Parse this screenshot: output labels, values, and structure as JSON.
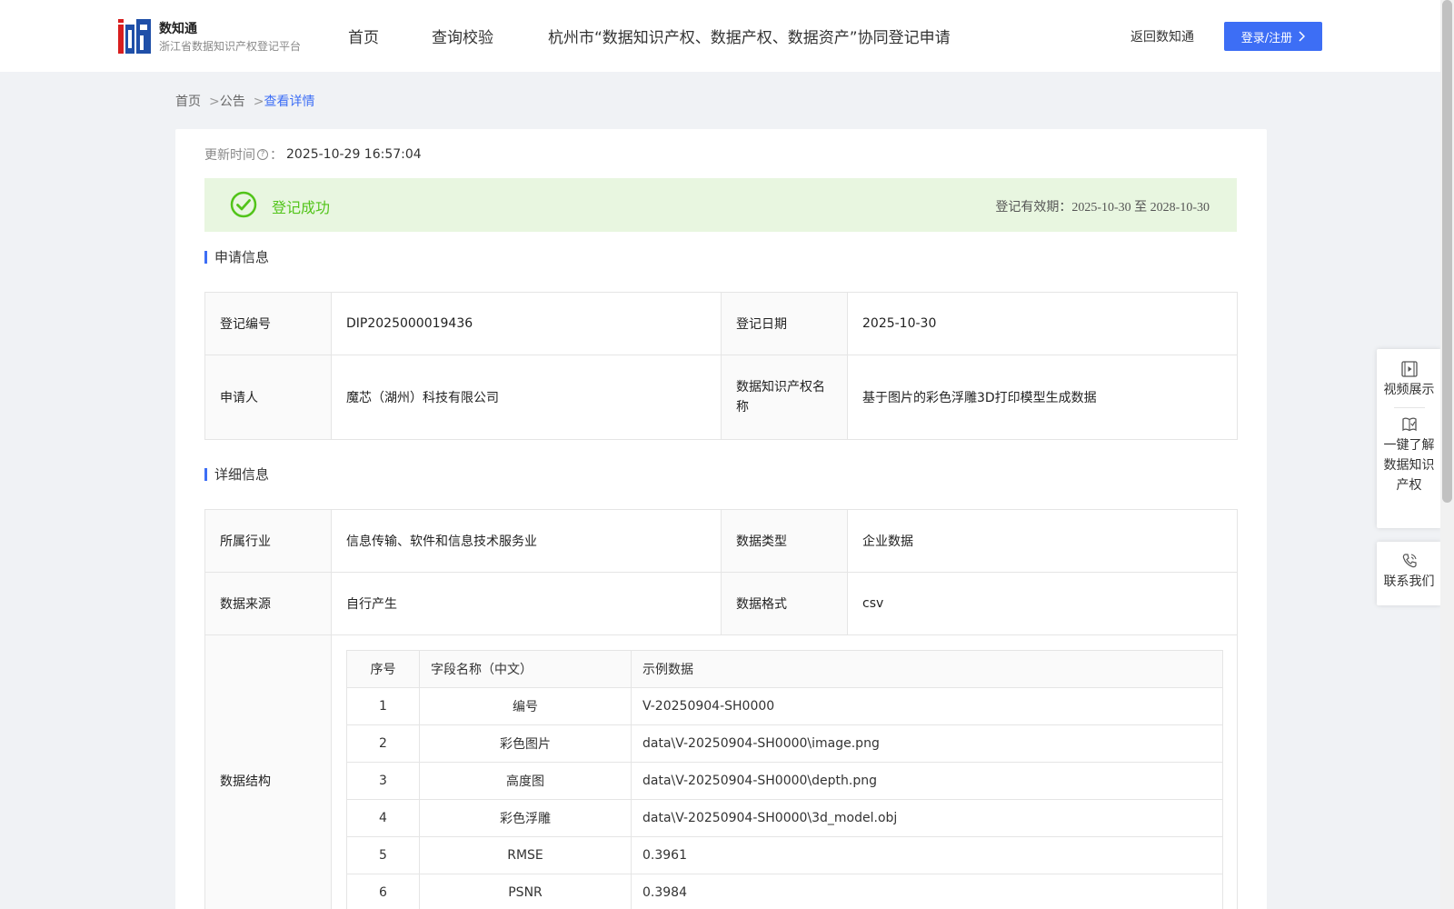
{
  "header": {
    "brand_name": "数知通",
    "brand_sub": "浙江省数据知识产权登记平台",
    "nav": [
      "首页",
      "查询校验",
      "杭州市“数据知识产权、数据产权、数据资产”协同登记申请"
    ],
    "back_link": "返回数知通",
    "login_label": "登录/注册"
  },
  "breadcrumb": {
    "home": "首页",
    "sep": ">",
    "notice": "公告",
    "current": "查看详情"
  },
  "update": {
    "label": "更新时间",
    "colon": "：",
    "value": "2025-10-29 16:57:04"
  },
  "status": {
    "text": "登记成功",
    "validity_label": "登记有效期：",
    "validity_dates": "2025-10-30 至 2028-10-30",
    "color": "#52c41a"
  },
  "application": {
    "title": "申请信息",
    "reg_no_label": "登记编号",
    "reg_no": "DIP2025000019436",
    "reg_date_label": "登记日期",
    "reg_date": "2025-10-30",
    "applicant_label": "申请人",
    "applicant": "魔芯（湖州）科技有限公司",
    "ip_name_label": "数据知识产权名称",
    "ip_name": "基于图片的彩色浮雕3D打印模型生成数据"
  },
  "details": {
    "title": "详细信息",
    "industry_label": "所属行业",
    "industry": "信息传输、软件和信息技术服务业",
    "data_type_label": "数据类型",
    "data_type": "企业数据",
    "source_label": "数据来源",
    "source": "自行产生",
    "format_label": "数据格式",
    "format": "csv",
    "structure_label": "数据结构",
    "columns": [
      "序号",
      "字段名称（中文）",
      "示例数据"
    ],
    "rows": [
      [
        "1",
        "编号",
        "V-20250904-SH0000"
      ],
      [
        "2",
        "彩色图片",
        "data\\V-20250904-SH0000\\image.png"
      ],
      [
        "3",
        "高度图",
        "data\\V-20250904-SH0000\\depth.png"
      ],
      [
        "4",
        "彩色浮雕",
        "data\\V-20250904-SH0000\\3d_model.obj"
      ],
      [
        "5",
        "RMSE",
        "0.3961"
      ],
      [
        "6",
        "PSNR",
        "0.3984"
      ]
    ]
  },
  "float": {
    "video": "视频展示",
    "learn": "一键了解数据知识产权",
    "contact": "联系我们"
  },
  "colors": {
    "accent": "#3d6ef5",
    "success_bg": "#e8f6e0"
  }
}
